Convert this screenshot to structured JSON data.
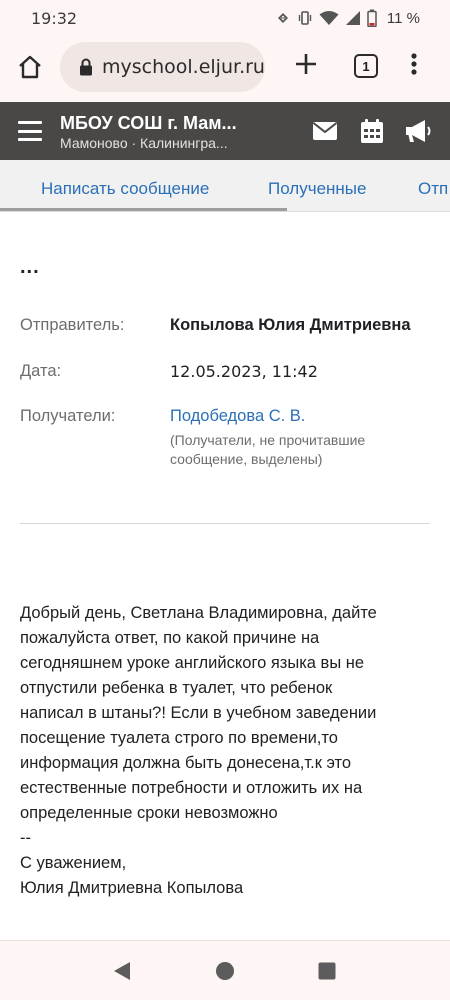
{
  "status_bar": {
    "time": "19:32",
    "battery": "11 %",
    "icons": [
      "data-saver-icon",
      "vibrate-icon",
      "wifi-icon",
      "signal-icon",
      "battery-low-icon"
    ]
  },
  "browser": {
    "url": "myschool.eljur.ru",
    "tab_count": "1",
    "icons": [
      "home-icon",
      "lock-icon",
      "plus-icon",
      "tabs-icon",
      "more-vert-icon"
    ]
  },
  "site_header": {
    "title": "МБОУ СОШ г. Мам...",
    "subtitle": "Мамоново · Калинингра...",
    "icons": [
      "hamburger-icon",
      "envelope-icon",
      "calendar-icon",
      "megaphone-icon"
    ]
  },
  "tabs": {
    "items": [
      {
        "label": "Написать сообщение"
      },
      {
        "label": "Полученные"
      },
      {
        "label": "Отп"
      }
    ],
    "active_index": 0
  },
  "message": {
    "ellipsis": "...",
    "sender_label": "Отправитель:",
    "sender_value": "Копылова Юлия Дмитриевна",
    "date_label": "Дата:",
    "date_value": "12.05.2023, 11:42",
    "recipients_label": "Получатели:",
    "recipient_value": "Подобедова С. В.",
    "recipients_note": "(Получатели, не прочитавшие сообщение, выделены)",
    "body_lines": [
      "Добрый день, Светлана Владимировна, дайте",
      "пожалуйста ответ, по какой причине на",
      "сегодняшнем уроке английского языка вы не",
      "отпустили ребенка в туалет, что ребенок",
      "написал в штаны?! Если в учебном заведении",
      "посещение туалета строго по времени,то",
      "информация должна быть донесена,т.к это",
      "естественные потребности и отложить их на",
      "определенные сроки невозможно",
      "--",
      "С уважением,",
      "Юлия Дмитриевна Копылова"
    ]
  },
  "nav_bar": {
    "icons": [
      "back-icon",
      "home-circle-icon",
      "recents-icon"
    ]
  },
  "colors": {
    "link": "#2a6fb8",
    "header_bg": "#4a4846",
    "chrome_bg": "#fdf6f5",
    "tabs_bg": "#f1f1f1"
  }
}
